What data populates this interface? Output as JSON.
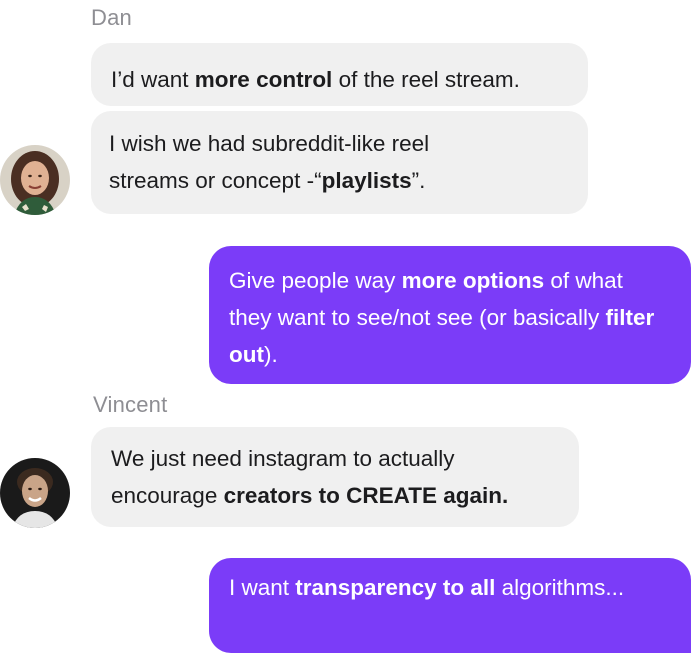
{
  "chat": {
    "group1": {
      "sender": "Dan",
      "m1": {
        "a": "I’d want ",
        "b": "more control",
        "c": " of the reel stream."
      },
      "m2": {
        "a": "I wish we had subreddit-like reel streams or concept -“",
        "b": "playlists",
        "c": "”."
      }
    },
    "out1": {
      "a": "Give people way ",
      "b": "more options",
      "c": " of what they want to see/not see (or basically ",
      "d": "filter out",
      "e": ")."
    },
    "group2": {
      "sender": "Vincent",
      "m1": {
        "a": "We just need instagram to actually encourage ",
        "b": "creators to CREATE again."
      }
    },
    "out2": {
      "a": "I want ",
      "b": "transparency to all",
      "c": " algorithms..."
    }
  },
  "colors": {
    "outgoing_bubble": "#7b3cf8",
    "incoming_bubble": "#f0f0f0",
    "sender_name": "#8e8e93"
  },
  "icons": {
    "avatar1": "woman-avatar-photo",
    "avatar2": "man-avatar-photo"
  }
}
